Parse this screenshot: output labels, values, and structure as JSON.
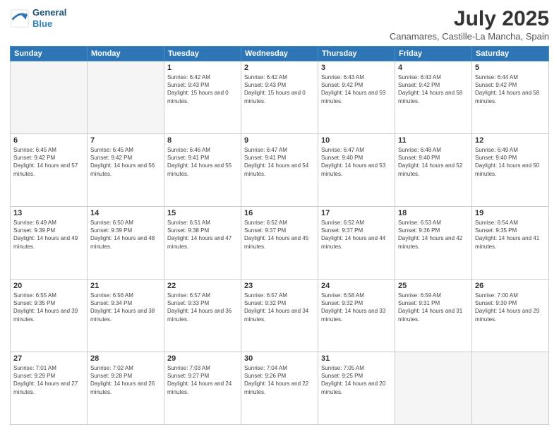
{
  "header": {
    "logo_line1": "General",
    "logo_line2": "Blue",
    "title": "July 2025",
    "subtitle": "Canamares, Castille-La Mancha, Spain"
  },
  "days_of_week": [
    "Sunday",
    "Monday",
    "Tuesday",
    "Wednesday",
    "Thursday",
    "Friday",
    "Saturday"
  ],
  "weeks": [
    [
      {
        "day": "",
        "sunrise": "",
        "sunset": "",
        "daylight": "",
        "empty": true
      },
      {
        "day": "",
        "sunrise": "",
        "sunset": "",
        "daylight": "",
        "empty": true
      },
      {
        "day": "1",
        "sunrise": "Sunrise: 6:42 AM",
        "sunset": "Sunset: 9:43 PM",
        "daylight": "Daylight: 15 hours and 0 minutes.",
        "empty": false
      },
      {
        "day": "2",
        "sunrise": "Sunrise: 6:42 AM",
        "sunset": "Sunset: 9:43 PM",
        "daylight": "Daylight: 15 hours and 0 minutes.",
        "empty": false
      },
      {
        "day": "3",
        "sunrise": "Sunrise: 6:43 AM",
        "sunset": "Sunset: 9:42 PM",
        "daylight": "Daylight: 14 hours and 59 minutes.",
        "empty": false
      },
      {
        "day": "4",
        "sunrise": "Sunrise: 6:43 AM",
        "sunset": "Sunset: 9:42 PM",
        "daylight": "Daylight: 14 hours and 58 minutes.",
        "empty": false
      },
      {
        "day": "5",
        "sunrise": "Sunrise: 6:44 AM",
        "sunset": "Sunset: 9:42 PM",
        "daylight": "Daylight: 14 hours and 58 minutes.",
        "empty": false
      }
    ],
    [
      {
        "day": "6",
        "sunrise": "Sunrise: 6:45 AM",
        "sunset": "Sunset: 9:42 PM",
        "daylight": "Daylight: 14 hours and 57 minutes.",
        "empty": false
      },
      {
        "day": "7",
        "sunrise": "Sunrise: 6:45 AM",
        "sunset": "Sunset: 9:42 PM",
        "daylight": "Daylight: 14 hours and 56 minutes.",
        "empty": false
      },
      {
        "day": "8",
        "sunrise": "Sunrise: 6:46 AM",
        "sunset": "Sunset: 9:41 PM",
        "daylight": "Daylight: 14 hours and 55 minutes.",
        "empty": false
      },
      {
        "day": "9",
        "sunrise": "Sunrise: 6:47 AM",
        "sunset": "Sunset: 9:41 PM",
        "daylight": "Daylight: 14 hours and 54 minutes.",
        "empty": false
      },
      {
        "day": "10",
        "sunrise": "Sunrise: 6:47 AM",
        "sunset": "Sunset: 9:40 PM",
        "daylight": "Daylight: 14 hours and 53 minutes.",
        "empty": false
      },
      {
        "day": "11",
        "sunrise": "Sunrise: 6:48 AM",
        "sunset": "Sunset: 9:40 PM",
        "daylight": "Daylight: 14 hours and 52 minutes.",
        "empty": false
      },
      {
        "day": "12",
        "sunrise": "Sunrise: 6:49 AM",
        "sunset": "Sunset: 9:40 PM",
        "daylight": "Daylight: 14 hours and 50 minutes.",
        "empty": false
      }
    ],
    [
      {
        "day": "13",
        "sunrise": "Sunrise: 6:49 AM",
        "sunset": "Sunset: 9:39 PM",
        "daylight": "Daylight: 14 hours and 49 minutes.",
        "empty": false
      },
      {
        "day": "14",
        "sunrise": "Sunrise: 6:50 AM",
        "sunset": "Sunset: 9:39 PM",
        "daylight": "Daylight: 14 hours and 48 minutes.",
        "empty": false
      },
      {
        "day": "15",
        "sunrise": "Sunrise: 6:51 AM",
        "sunset": "Sunset: 9:38 PM",
        "daylight": "Daylight: 14 hours and 47 minutes.",
        "empty": false
      },
      {
        "day": "16",
        "sunrise": "Sunrise: 6:52 AM",
        "sunset": "Sunset: 9:37 PM",
        "daylight": "Daylight: 14 hours and 45 minutes.",
        "empty": false
      },
      {
        "day": "17",
        "sunrise": "Sunrise: 6:52 AM",
        "sunset": "Sunset: 9:37 PM",
        "daylight": "Daylight: 14 hours and 44 minutes.",
        "empty": false
      },
      {
        "day": "18",
        "sunrise": "Sunrise: 6:53 AM",
        "sunset": "Sunset: 9:36 PM",
        "daylight": "Daylight: 14 hours and 42 minutes.",
        "empty": false
      },
      {
        "day": "19",
        "sunrise": "Sunrise: 6:54 AM",
        "sunset": "Sunset: 9:35 PM",
        "daylight": "Daylight: 14 hours and 41 minutes.",
        "empty": false
      }
    ],
    [
      {
        "day": "20",
        "sunrise": "Sunrise: 6:55 AM",
        "sunset": "Sunset: 9:35 PM",
        "daylight": "Daylight: 14 hours and 39 minutes.",
        "empty": false
      },
      {
        "day": "21",
        "sunrise": "Sunrise: 6:56 AM",
        "sunset": "Sunset: 9:34 PM",
        "daylight": "Daylight: 14 hours and 38 minutes.",
        "empty": false
      },
      {
        "day": "22",
        "sunrise": "Sunrise: 6:57 AM",
        "sunset": "Sunset: 9:33 PM",
        "daylight": "Daylight: 14 hours and 36 minutes.",
        "empty": false
      },
      {
        "day": "23",
        "sunrise": "Sunrise: 6:57 AM",
        "sunset": "Sunset: 9:32 PM",
        "daylight": "Daylight: 14 hours and 34 minutes.",
        "empty": false
      },
      {
        "day": "24",
        "sunrise": "Sunrise: 6:58 AM",
        "sunset": "Sunset: 9:32 PM",
        "daylight": "Daylight: 14 hours and 33 minutes.",
        "empty": false
      },
      {
        "day": "25",
        "sunrise": "Sunrise: 6:59 AM",
        "sunset": "Sunset: 9:31 PM",
        "daylight": "Daylight: 14 hours and 31 minutes.",
        "empty": false
      },
      {
        "day": "26",
        "sunrise": "Sunrise: 7:00 AM",
        "sunset": "Sunset: 9:30 PM",
        "daylight": "Daylight: 14 hours and 29 minutes.",
        "empty": false
      }
    ],
    [
      {
        "day": "27",
        "sunrise": "Sunrise: 7:01 AM",
        "sunset": "Sunset: 9:29 PM",
        "daylight": "Daylight: 14 hours and 27 minutes.",
        "empty": false
      },
      {
        "day": "28",
        "sunrise": "Sunrise: 7:02 AM",
        "sunset": "Sunset: 9:28 PM",
        "daylight": "Daylight: 14 hours and 26 minutes.",
        "empty": false
      },
      {
        "day": "29",
        "sunrise": "Sunrise: 7:03 AM",
        "sunset": "Sunset: 9:27 PM",
        "daylight": "Daylight: 14 hours and 24 minutes.",
        "empty": false
      },
      {
        "day": "30",
        "sunrise": "Sunrise: 7:04 AM",
        "sunset": "Sunset: 9:26 PM",
        "daylight": "Daylight: 14 hours and 22 minutes.",
        "empty": false
      },
      {
        "day": "31",
        "sunrise": "Sunrise: 7:05 AM",
        "sunset": "Sunset: 9:25 PM",
        "daylight": "Daylight: 14 hours and 20 minutes.",
        "empty": false
      },
      {
        "day": "",
        "sunrise": "",
        "sunset": "",
        "daylight": "",
        "empty": true
      },
      {
        "day": "",
        "sunrise": "",
        "sunset": "",
        "daylight": "",
        "empty": true
      }
    ]
  ]
}
